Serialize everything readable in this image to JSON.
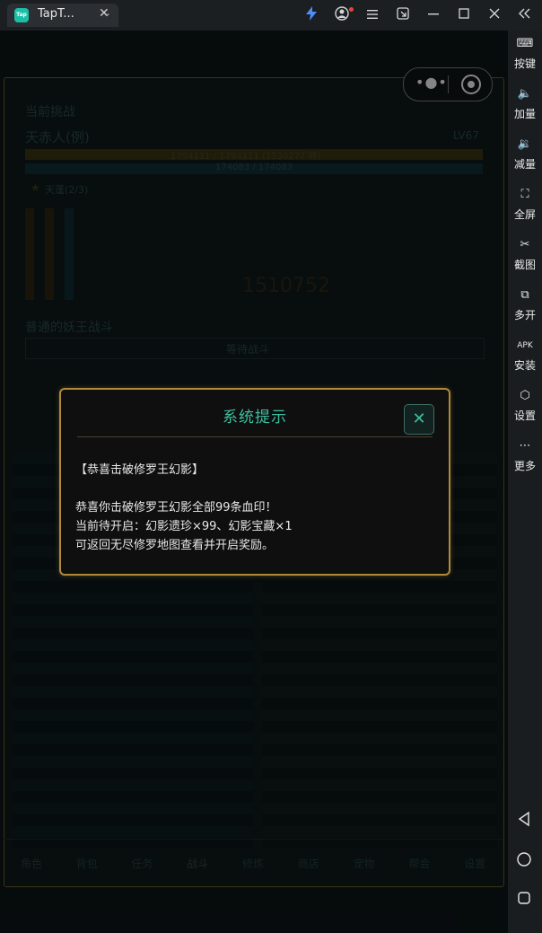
{
  "browser": {
    "tab_title": "TapT...",
    "tab_logo_text": "Tap",
    "close_glyph": "✕",
    "dropdown_glyph": "⌄",
    "toolbar_icons": [
      "bolt-icon",
      "account-icon",
      "menu-icon",
      "picture-in-picture-icon",
      "minimize-icon",
      "maximize-icon",
      "close-icon",
      "collapse-sidebar-icon"
    ]
  },
  "sidebar": {
    "items": [
      {
        "label": "按键",
        "icon": "keyboard-icon"
      },
      {
        "label": "加量",
        "icon": "volume-up-icon"
      },
      {
        "label": "减量",
        "icon": "volume-down-icon"
      },
      {
        "label": "全屏",
        "icon": "fullscreen-icon"
      },
      {
        "label": "截图",
        "icon": "scissors-icon"
      },
      {
        "label": "多开",
        "icon": "multi-instance-icon"
      },
      {
        "label": "安装",
        "icon": "apk-icon"
      },
      {
        "label": "设置",
        "icon": "settings-icon"
      },
      {
        "label": "更多",
        "icon": "more-icon"
      }
    ],
    "nav": [
      "back-icon",
      "home-icon",
      "recent-apps-icon"
    ]
  },
  "miniprogram": {
    "more_icon": "more-dots-icon",
    "close_icon": "target-close-icon"
  },
  "background": {
    "current_challenge": "当前挑战",
    "enemy_name": "天赤人(例)",
    "enemy_level": "LV67",
    "enemy_hp": "1794111 / 1794111 (1530277 转)",
    "player_hp": "174083 / 174083",
    "skill_label": "天蓬(2/3)",
    "big_number": "1510752",
    "section_label": "普通的妖王战斗",
    "waiting_label": "等待战斗",
    "bottom_tabs": [
      "角色",
      "背包",
      "任务",
      "战斗",
      "修炼",
      "商店",
      "宠物",
      "帮会",
      "设置"
    ]
  },
  "dialog": {
    "title": "系统提示",
    "close_glyph": "✕",
    "lines": [
      "【恭喜击破修罗王幻影】",
      "",
      "恭喜你击破修罗王幻影全部99条血印！",
      "当前待开启：幻影遗珍×99、幻影宝藏×1",
      "可返回无尽修罗地图查看并开启奖励。"
    ]
  },
  "colors": {
    "accent": "#3fbfa0",
    "dialog_border": "#b08a3a",
    "dialog_bg": "#0f0f0f"
  }
}
